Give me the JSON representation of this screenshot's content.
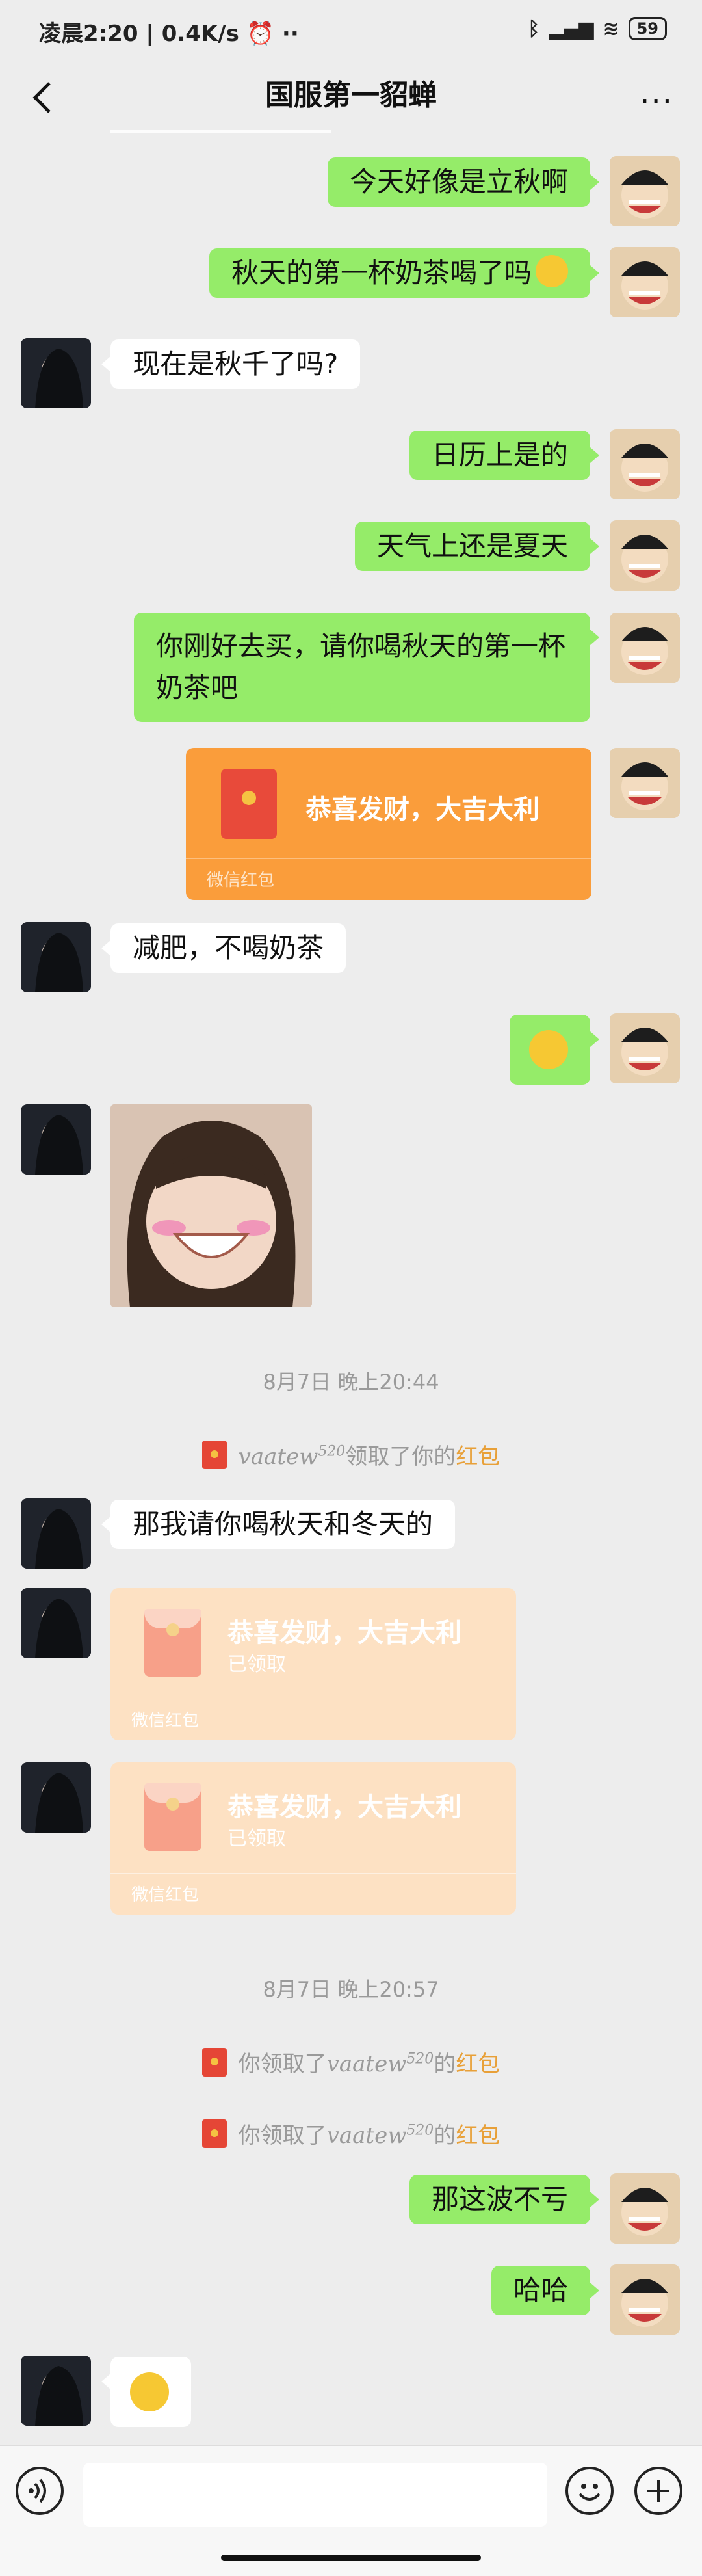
{
  "status": {
    "time": "凌晨2:20",
    "speed": "0.4K/s",
    "battery": "59"
  },
  "nav": {
    "title": "国服第一貂蝉",
    "more": "···"
  },
  "messages": {
    "m1": "今天好像是立秋啊",
    "m2": "秋天的第一杯奶茶喝了吗",
    "m3": "现在是秋千了吗?",
    "m4": "日历上是的",
    "m5": "天气上还是夏天",
    "m6": "你刚好去买，请你喝秋天的第一杯奶茶吧",
    "m8": "减肥，不喝奶茶",
    "m11": "那我请你喝秋天和冬天的",
    "m14": "那这波不亏",
    "m15": "哈哈"
  },
  "redpacket": {
    "greeting": "恭喜发财，大吉大利",
    "footer": "微信红包",
    "claimed": "已领取"
  },
  "timestamps": {
    "t1": "8月7日 晚上20:44",
    "t2": "8月7日 晚上20:57"
  },
  "system": {
    "s1_sig": "vaatew",
    "s1_sup": "520",
    "s1_text": "领取了你的",
    "s1_link": "红包",
    "s2_pre": "你领取了",
    "s2_sig": "vaatew",
    "s2_sup": "520",
    "s2_text": "的",
    "s2_link": "红包"
  },
  "colors": {
    "me_bubble": "#95ec69",
    "other_bubble": "#ffffff",
    "redpacket": "#fa9d3b",
    "redpacket_claimed": "#fde1c3"
  }
}
